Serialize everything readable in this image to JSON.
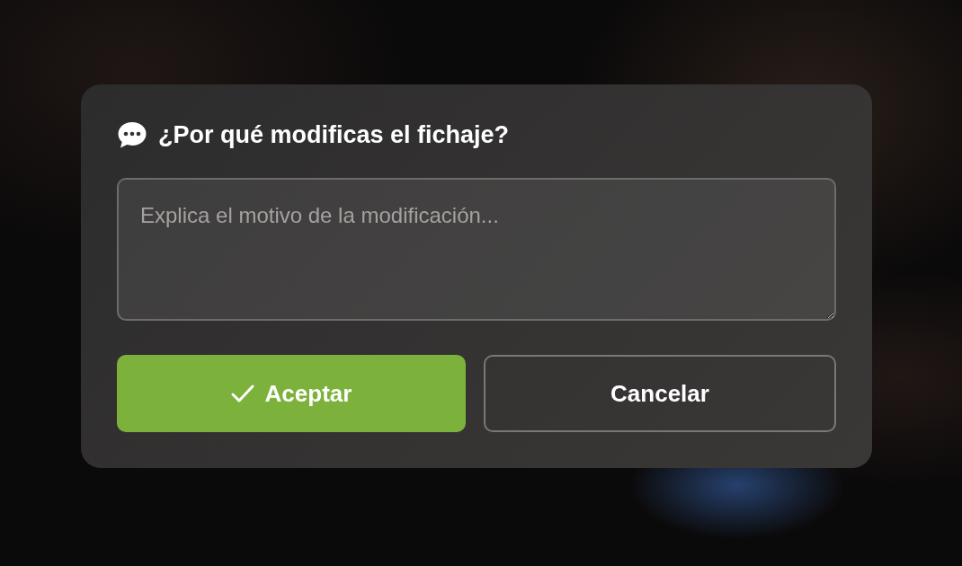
{
  "dialog": {
    "title": "¿Por qué modificas el fichaje?",
    "reason_field": {
      "placeholder": "Explica el motivo de la modificación..."
    },
    "buttons": [
      {
        "kind": "primary",
        "label": "Aceptar"
      },
      {
        "kind": "secondary",
        "label": "Cancelar"
      }
    ]
  }
}
